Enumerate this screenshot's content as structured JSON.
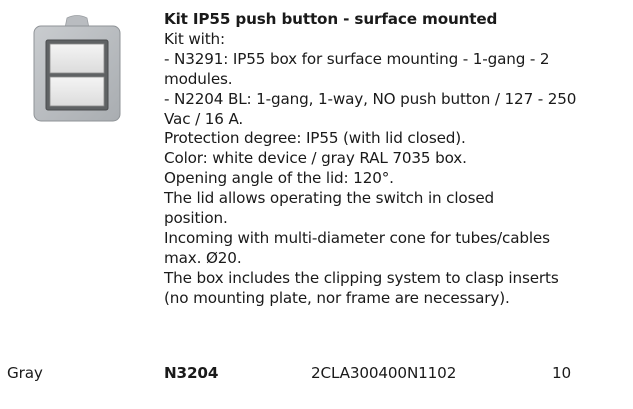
{
  "product": {
    "image_icon": "ip55-surface-box-icon",
    "title": "Kit IP55 push button - surface mounted",
    "lines": [
      "Kit with:",
      "- N3291: IP55 box for surface mounting - 1-gang - 2",
      "modules.",
      "- N2204 BL: 1-gang, 1-way, NO push button / 127 - 250",
      "Vac / 16 A.",
      "Protection degree: IP55 (with lid closed).",
      "Color: white device / gray RAL 7035 box.",
      "Opening angle of the lid: 120°.",
      "The lid allows operating the switch in closed",
      "position.",
      "Incoming with multi-diameter cone for tubes/cables",
      "max. Ø20.",
      "The box includes the clipping system to clasp inserts",
      "(no mounting plate, nor frame are necessary)."
    ]
  },
  "row": {
    "color": "Gray",
    "code": "N3204",
    "reference": "2CLA300400N1102",
    "quantity": "10"
  }
}
